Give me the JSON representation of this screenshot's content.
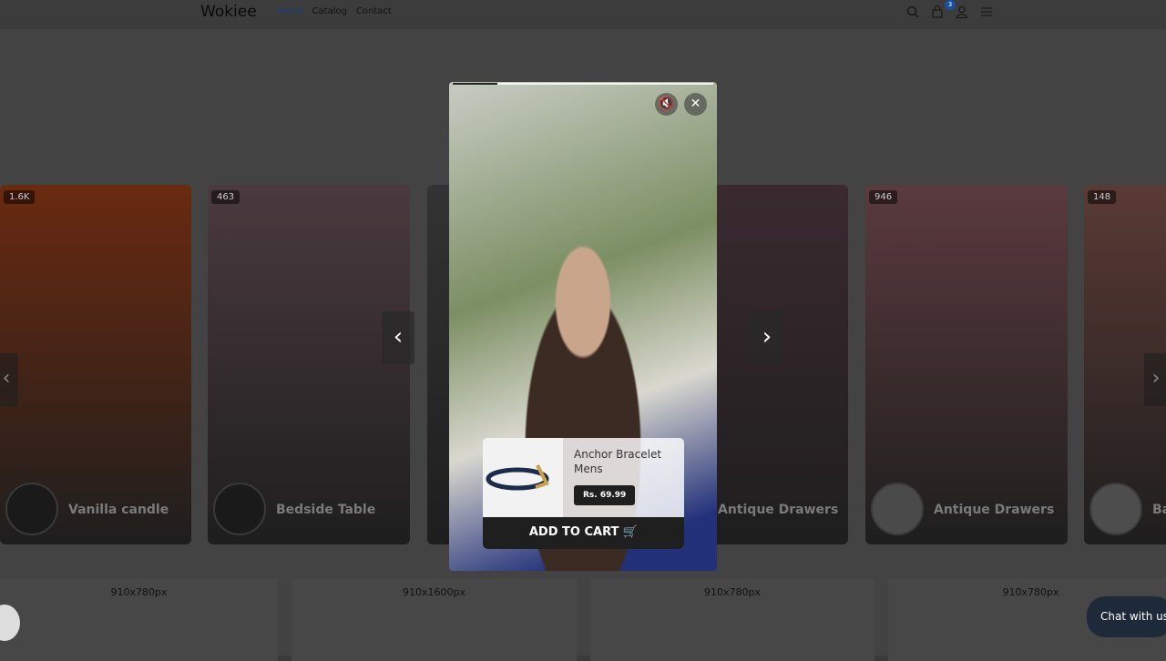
{
  "header": {
    "logo": "Wokiee",
    "nav": [
      {
        "label": "Home",
        "active": true
      },
      {
        "label": "Catalog"
      },
      {
        "label": "Contact"
      }
    ],
    "cart_count": "3",
    "icons": [
      "search-icon",
      "shopping-bag-icon",
      "user-icon",
      "sliders-icon"
    ]
  },
  "cards": [
    {
      "views": "1.6K",
      "name": "Vanilla candle",
      "color": "#6a2a10"
    },
    {
      "views": "463",
      "name": "Bedside Table",
      "color": "#4a3a40"
    },
    {
      "views": "",
      "name": "",
      "color": "#333"
    },
    {
      "views": "",
      "name": "Antique Drawers",
      "color": "#3a2a30"
    },
    {
      "views": "946",
      "name": "Antique Drawers",
      "color": "#5a3a3e"
    },
    {
      "views": "148",
      "name": "Ba",
      "color": "#5a3a35"
    }
  ],
  "placeholders": [
    "910x780px",
    "910x1600px",
    "910x780px",
    "910x780px"
  ],
  "modal": {
    "progress_percent": 17,
    "mute_icon": "speaker-muted-icon",
    "close_icon": "close-icon",
    "product": {
      "name": "Anchor Bracelet Mens",
      "price": "Rs. 69.99",
      "add_to_cart": "ADD TO CART"
    }
  },
  "chat": {
    "label": "Chat with us"
  }
}
